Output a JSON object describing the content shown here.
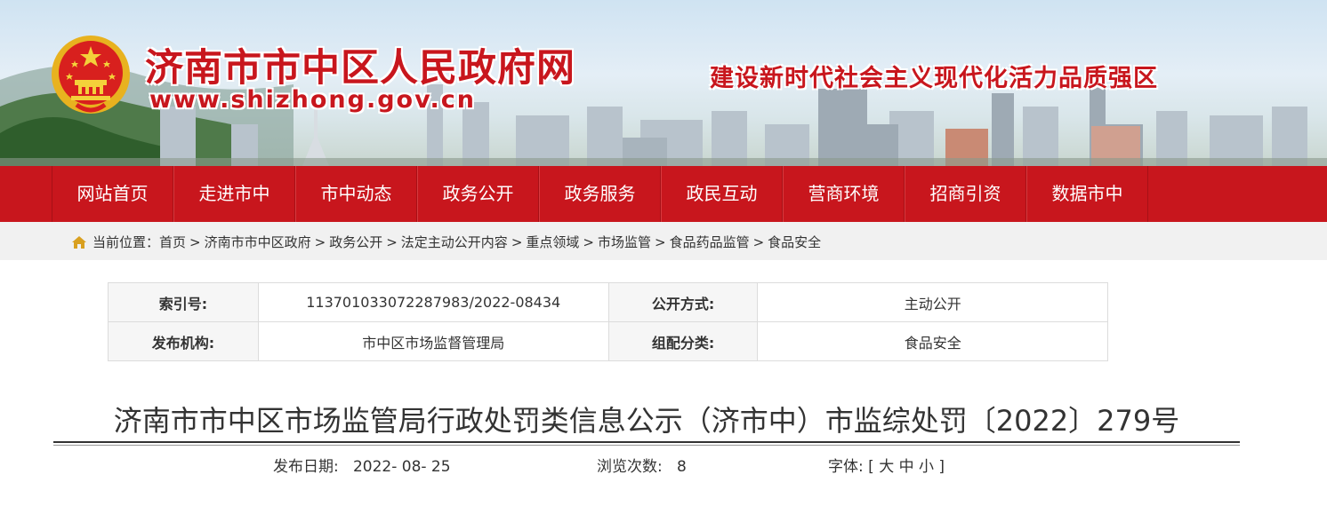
{
  "header": {
    "site_title": "济南市市中区人民政府网",
    "site_url": "www.shizhong.gov.cn",
    "slogan": "建设新时代社会主义现代化活力品质强区"
  },
  "nav": {
    "items": [
      "网站首页",
      "走进市中",
      "市中动态",
      "政务公开",
      "政务服务",
      "政民互动",
      "营商环境",
      "招商引资",
      "数据市中"
    ]
  },
  "breadcrumb": {
    "prefix": "当前位置：",
    "items": [
      "首页",
      "济南市市中区政府",
      "政务公开",
      "法定主动公开内容",
      "重点领域",
      "市场监管",
      "食品药品监管",
      "食品安全"
    ],
    "separator": ">"
  },
  "info_table": {
    "index_label": "索引号:",
    "index_value": "11370103307228798​3/2022-08434",
    "disclosure_label": "公开方式:",
    "disclosure_value": "主动公开",
    "publisher_label": "发布机构:",
    "publisher_value": "市中区市场监督管理局",
    "category_label": "组配分类:",
    "category_value": "食品安全"
  },
  "article": {
    "title": "济南市市中区市场监管局行政处罚类信息公示（济市中）市监综处罚〔2022〕279号",
    "date_label": "发布日期:",
    "date_value": "2022- 08- 25",
    "views_label": "浏览次数:",
    "views_value": "8",
    "font_label": "字体:",
    "font_open": "[",
    "font_large": "大",
    "font_medium": "中",
    "font_small": "小",
    "font_close": "]"
  },
  "colors": {
    "brand_red": "#c8161d",
    "nav_bg": "#c8161d",
    "crumb_bg": "#f1f1f1"
  },
  "icons": {
    "emblem": "national-emblem",
    "breadcrumb": "home-icon"
  }
}
